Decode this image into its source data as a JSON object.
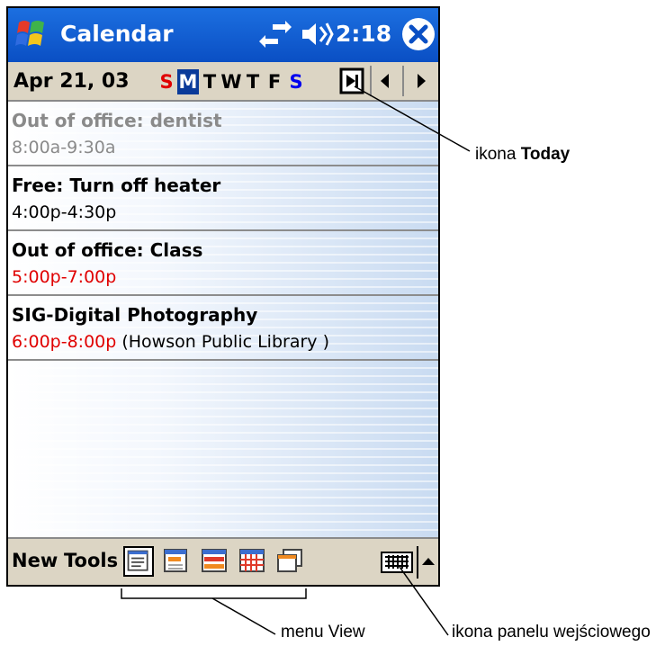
{
  "titlebar": {
    "app_title": "Calendar",
    "time": "2:18"
  },
  "datebar": {
    "date": "Apr 21, 03",
    "weekdays": [
      "S",
      "M",
      "T",
      "W",
      "T",
      "F",
      "S"
    ],
    "selected_day": "M"
  },
  "appointments": [
    {
      "title": "Out of office: dentist",
      "time": "8:00a-9:30a",
      "location": "",
      "state": "past"
    },
    {
      "title": "Free: Turn off heater",
      "time": "4:00p-4:30p",
      "location": "",
      "state": "normal"
    },
    {
      "title": "Out of office: Class",
      "time": "5:00p-7:00p",
      "location": "",
      "state": "busy"
    },
    {
      "title": "SIG-Digital Photography",
      "time": "6:00p-8:00p",
      "location": "(Howson Public Library )",
      "state": "busy"
    }
  ],
  "menubar": {
    "new_label": "New",
    "tools_label": "Tools"
  },
  "callouts": {
    "today_prefix": "ikona ",
    "today_bold": "Today",
    "view_menu": "menu View",
    "input_panel": "ikona panelu wejściowego"
  },
  "colors": {
    "titlebar": "#0a4fc4",
    "selected_day": "#0a3a99",
    "sunday": "#e00000",
    "saturday": "#0000ee",
    "busy_time": "#e00000",
    "bars": "#dcd5c4"
  },
  "icons": [
    "windows-start-icon",
    "sync-icon",
    "speaker-icon",
    "close-icon",
    "today-icon",
    "prev-arrow-icon",
    "next-arrow-icon",
    "agenda-view-icon",
    "day-view-icon",
    "week-view-icon",
    "month-view-icon",
    "year-view-icon",
    "keyboard-icon",
    "up-arrow-icon"
  ]
}
